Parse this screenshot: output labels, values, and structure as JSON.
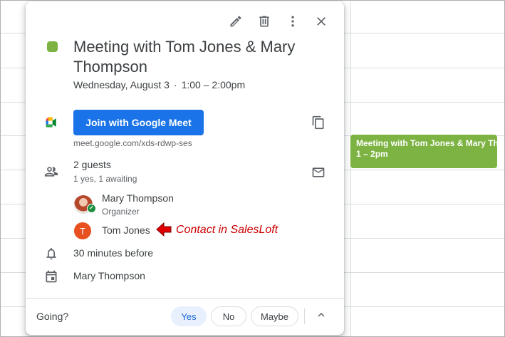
{
  "event": {
    "title": "Meeting with Tom Jones & Mary Thompson",
    "date": "Wednesday, August 3",
    "separator": "·",
    "time": "1:00 – 2:00pm",
    "color": "#7cb342"
  },
  "calendar_chip": {
    "title": "Meeting with Tom Jones & Mary Thompson",
    "time": "1 – 2pm"
  },
  "toolbar": {
    "icons": [
      "edit-icon",
      "delete-icon",
      "more-options-icon",
      "close-icon"
    ]
  },
  "meet": {
    "button_label": "Join with Google Meet",
    "link": "meet.google.com/xds-rdwp-ses",
    "brand_color": "#1a73e8"
  },
  "guests": {
    "count_label": "2 guests",
    "status_label": "1 yes, 1 awaiting",
    "list": [
      {
        "name": "Mary Thompson",
        "role": "Organizer"
      },
      {
        "name": "Tom Jones",
        "initial": "T"
      }
    ]
  },
  "annotation": {
    "text": "Contact in SalesLoft",
    "color": "#cc0000"
  },
  "reminder": "30 minutes before",
  "calendar_owner": "Mary Thompson",
  "rsvp": {
    "prompt": "Going?",
    "yes": "Yes",
    "no": "No",
    "maybe": "Maybe",
    "selected": "Yes"
  }
}
